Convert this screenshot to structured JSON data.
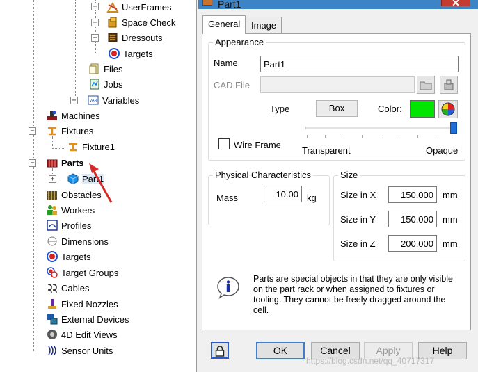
{
  "tree": {
    "items": [
      {
        "label": "UserFrames",
        "icon": "userframes-icon"
      },
      {
        "label": "Space Check",
        "icon": "space-check-icon"
      },
      {
        "label": "Dressouts",
        "icon": "dressouts-icon"
      },
      {
        "label": "Targets",
        "icon": "targets-icon"
      },
      {
        "label": "Files",
        "icon": "files-icon"
      },
      {
        "label": "Jobs",
        "icon": "jobs-icon"
      },
      {
        "label": "Variables",
        "icon": "variables-icon"
      },
      {
        "label": "Machines",
        "icon": "machines-icon"
      },
      {
        "label": "Fixtures",
        "icon": "fixtures-icon"
      },
      {
        "label": "Fixture1",
        "icon": "fixture-icon"
      },
      {
        "label": "Parts",
        "icon": "parts-icon"
      },
      {
        "label": "Part1",
        "icon": "part-cube-icon"
      },
      {
        "label": "Obstacles",
        "icon": "obstacles-icon"
      },
      {
        "label": "Workers",
        "icon": "workers-icon"
      },
      {
        "label": "Profiles",
        "icon": "profiles-icon"
      },
      {
        "label": "Dimensions",
        "icon": "dimensions-icon"
      },
      {
        "label": "Targets",
        "icon": "targets-icon"
      },
      {
        "label": "Target Groups",
        "icon": "target-groups-icon"
      },
      {
        "label": "Cables",
        "icon": "cables-icon"
      },
      {
        "label": "Fixed Nozzles",
        "icon": "fixed-nozzles-icon"
      },
      {
        "label": "External Devices",
        "icon": "external-devices-icon"
      },
      {
        "label": "4D Edit Views",
        "icon": "edit-views-icon"
      },
      {
        "label": "Sensor Units",
        "icon": "sensor-units-icon"
      }
    ]
  },
  "dialog": {
    "title": "Part1",
    "close_label": "✕",
    "tabs": [
      {
        "label": "General"
      },
      {
        "label": "Image"
      }
    ],
    "appearance": {
      "group_label": "Appearance",
      "name_label": "Name",
      "name_value": "Part1",
      "cad_label": "CAD File",
      "cad_value": "",
      "type_label": "Type",
      "type_value": "Box",
      "color_label": "Color:",
      "color_value": "#00e600",
      "wireframe_label": "Wire Frame",
      "wireframe_checked": false,
      "transparent_label": "Transparent",
      "opaque_label": "Opaque",
      "opacity_fraction": 1.0
    },
    "physical": {
      "group_label": "Physical Characteristics",
      "mass_label": "Mass",
      "mass_value": "10.00",
      "mass_unit": "kg"
    },
    "size": {
      "group_label": "Size",
      "x_label": "Size in X",
      "x_value": "150.000",
      "y_label": "Size in Y",
      "y_value": "150.000",
      "z_label": "Size in Z",
      "z_value": "200.000",
      "unit": "mm"
    },
    "info_text": "Parts are special objects in that they are only visible on the part rack or when assigned to fixtures or tooling.  They cannot be freely dragged around the cell.",
    "buttons": {
      "ok": "OK",
      "cancel": "Cancel",
      "apply": "Apply",
      "help": "Help"
    }
  },
  "watermark": "https://blog.csdn.net/qq_40717317",
  "colors": {
    "accent": "#3c84c6",
    "close": "#c43c30",
    "arrow": "#d42a2a"
  }
}
